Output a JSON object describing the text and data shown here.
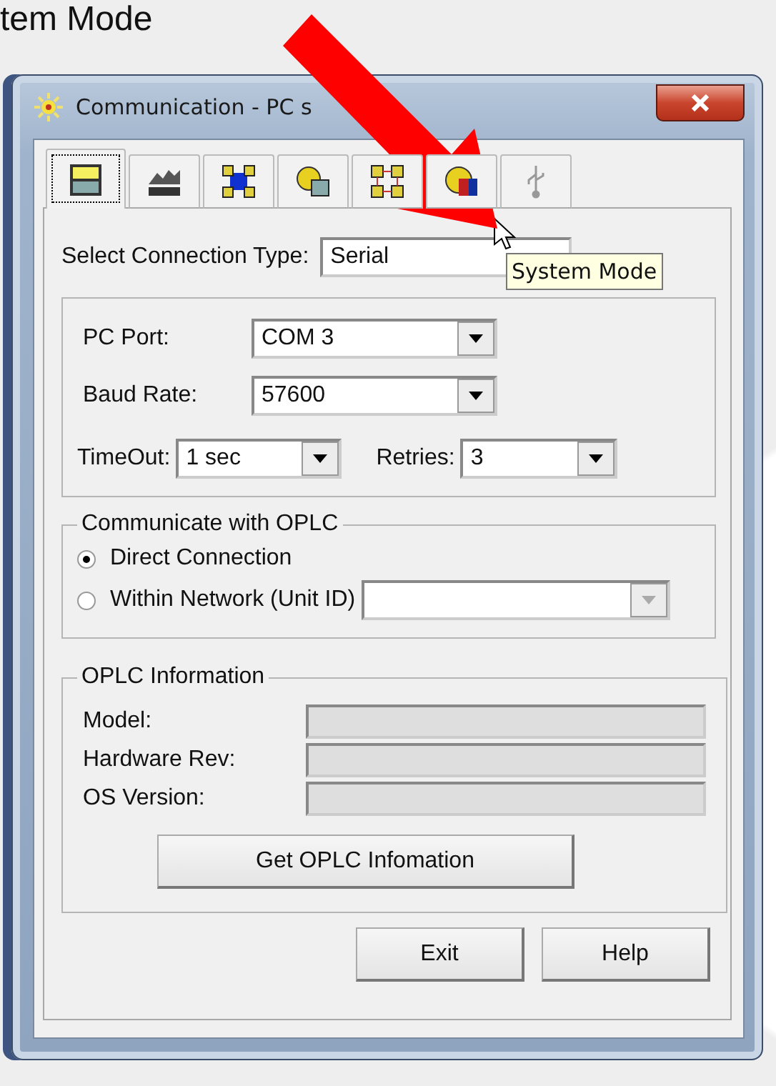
{
  "slide_title": "tem Mode",
  "window": {
    "title": "Communication - PC s"
  },
  "tabs": [
    {
      "kind": "keypad",
      "selected": true
    },
    {
      "kind": "plant",
      "selected": false
    },
    {
      "kind": "network",
      "selected": false
    },
    {
      "kind": "sun-device",
      "selected": false
    },
    {
      "kind": "nodes",
      "selected": false
    },
    {
      "kind": "system",
      "selected": false
    },
    {
      "kind": "usb",
      "selected": false
    }
  ],
  "tooltip": "System Mode",
  "connection_type": {
    "label": "Select Connection Type:",
    "value": "Serial"
  },
  "port_settings": {
    "pc_port": {
      "label": "PC Port:",
      "value": "COM 3"
    },
    "baud_rate": {
      "label": "Baud Rate:",
      "value": "57600"
    },
    "timeout": {
      "label": "TimeOut:",
      "value": "1 sec"
    },
    "retries": {
      "label": "Retries:",
      "value": "3"
    }
  },
  "communicate": {
    "title": "Communicate with OPLC",
    "options": [
      {
        "label": "Direct Connection",
        "selected": true
      },
      {
        "label": "Within Network (Unit ID)",
        "selected": false
      }
    ],
    "unit_id": {
      "disabled": true
    }
  },
  "info": {
    "title": "OPLC Information",
    "fields": [
      {
        "label": "Model:"
      },
      {
        "label": "Hardware Rev:"
      },
      {
        "label": "OS Version:"
      }
    ],
    "button": "Get OPLC Infomation"
  },
  "buttons": [
    "Exit",
    "Help"
  ]
}
